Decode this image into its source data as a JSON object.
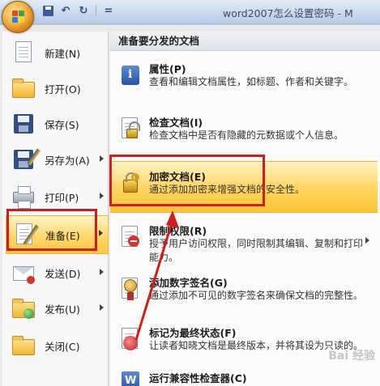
{
  "window": {
    "title": "word2007怎么设置密码 - M"
  },
  "qat": {
    "undo_glyph": "↶",
    "redo_glyph": "↻",
    "more_glyph": "="
  },
  "left_menu": {
    "items": [
      {
        "label": "新建(N)",
        "icon": "new-document-icon",
        "has_arrow": false
      },
      {
        "label": "打开(O)",
        "icon": "open-folder-icon",
        "has_arrow": false
      },
      {
        "label": "保存(S)",
        "icon": "save-disk-icon",
        "has_arrow": false
      },
      {
        "label": "另存为(A)",
        "icon": "save-as-icon",
        "has_arrow": true
      },
      {
        "label": "打印(P)",
        "icon": "printer-icon",
        "has_arrow": true
      },
      {
        "label": "准备(E)",
        "icon": "prepare-pen-icon",
        "has_arrow": true,
        "active": true
      },
      {
        "label": "发送(D)",
        "icon": "send-envelope-icon",
        "has_arrow": true
      },
      {
        "label": "发布(U)",
        "icon": "publish-icon",
        "has_arrow": true
      },
      {
        "label": "关闭(C)",
        "icon": "close-folder-icon",
        "has_arrow": false
      }
    ]
  },
  "right_pane": {
    "header": "准备要分发的文档",
    "items": [
      {
        "title": "属性(P)",
        "desc": "查看和编辑文档属性，如标题、作者和关键字。",
        "icon": "properties-info-icon"
      },
      {
        "title": "检查文档(I)",
        "desc": "检查文档中是否有隐藏的元数据或个人信息。",
        "icon": "inspect-document-icon"
      },
      {
        "title": "加密文档(E)",
        "desc": "通过添加加密来增强文档的安全性。",
        "icon": "encrypt-lock-icon",
        "hover": true
      },
      {
        "title": "限制权限(R)",
        "desc": "授予用户访问权限，同时限制其编辑、复制和打印能力。",
        "icon": "restrict-permission-icon",
        "has_arrow": true
      },
      {
        "title": "添加数字签名(G)",
        "desc": "通过添加不可见的数字签名来确保文档的完整性。",
        "icon": "digital-signature-icon"
      },
      {
        "title": "标记为最终状态(F)",
        "desc": "让读者知晓文档是最终版本，并将其设为只读的。",
        "icon": "mark-final-icon"
      },
      {
        "title": "运行兼容性检查器(C)",
        "desc": "",
        "icon": "compatibility-checker-icon"
      }
    ]
  },
  "colors": {
    "highlight": "#d31d1d",
    "hover_gold": "#ffd45e"
  },
  "watermark": "Bai 经验"
}
